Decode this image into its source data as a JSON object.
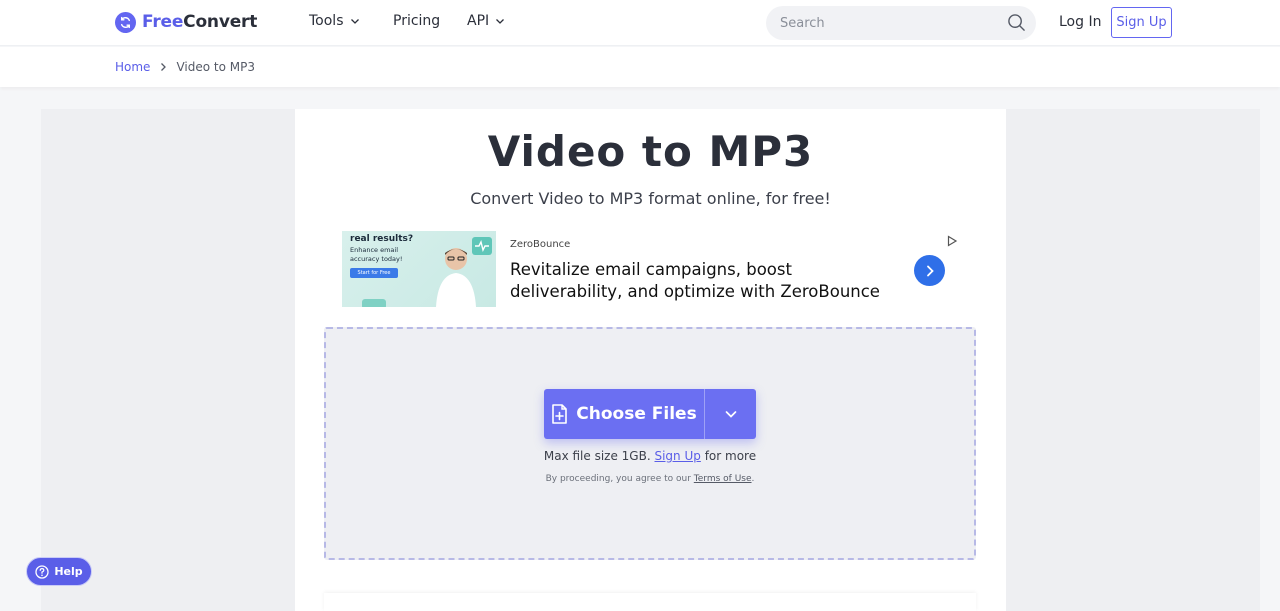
{
  "header": {
    "logo_free": "Free",
    "logo_convert": "Convert",
    "nav": [
      {
        "label": "Tools",
        "has_dropdown": true
      },
      {
        "label": "Pricing",
        "has_dropdown": false
      },
      {
        "label": "API",
        "has_dropdown": true
      }
    ],
    "search_placeholder": "Search",
    "login_label": "Log In",
    "signup_label": "Sign Up"
  },
  "breadcrumb": {
    "home": "Home",
    "current": "Video to MP3"
  },
  "main": {
    "title": "Video to MP3",
    "subtitle": "Convert Video to MP3 format online, for free!"
  },
  "ad": {
    "image_heading": "real results?",
    "image_sub": "Enhance email accuracy today!",
    "image_button": "Start for Free",
    "brand": "ZeroBounce",
    "headline": "Revitalize email campaigns, boost deliverability, and optimize with ZeroBounce"
  },
  "upload": {
    "choose_label": "Choose Files",
    "max_prefix": "Max file size 1GB.",
    "max_link": "Sign Up",
    "max_suffix": "for more",
    "terms_prefix": "By proceeding, you agree to our",
    "terms_link": "Terms of Use",
    "terms_suffix": "."
  },
  "help": {
    "label": "Help"
  },
  "colors": {
    "accent": "#6366f1",
    "ad_button": "#2f6fe8"
  }
}
